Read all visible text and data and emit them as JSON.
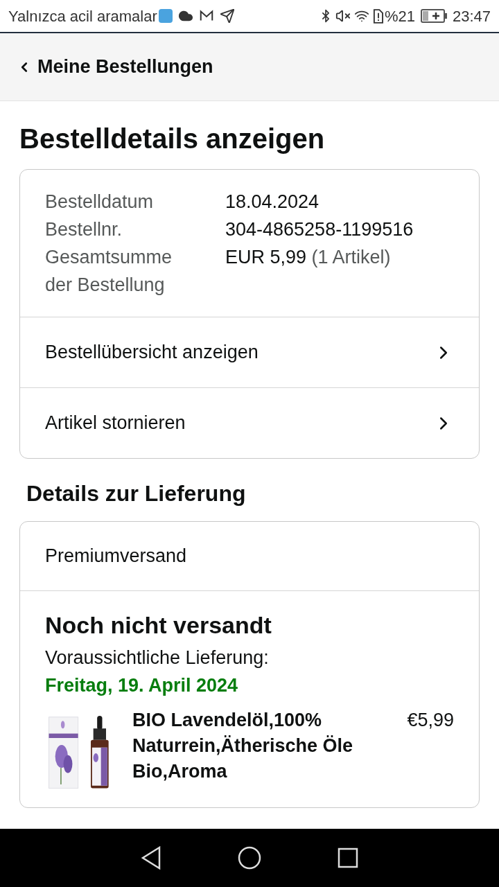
{
  "status_bar": {
    "carrier_text": "Yalnızca acil aramalar",
    "battery": "%21",
    "time": "23:47"
  },
  "header": {
    "title": "Meine Bestellungen"
  },
  "page_title": "Bestelldetails anzeigen",
  "order_summary": {
    "fields": [
      {
        "label": "Bestelldatum",
        "value": "18.04.2024"
      },
      {
        "label": "Bestellnr.",
        "value": "304-4865258-1199516"
      },
      {
        "label": "Gesamtsumme der Bestellung",
        "value": "EUR 5,99",
        "note": "(1 Artikel)"
      }
    ],
    "links": [
      "Bestellübersicht anzeigen",
      "Artikel stornieren"
    ]
  },
  "delivery": {
    "heading": "Details zur Lieferung",
    "shipping": "Premiumversand",
    "status": "Noch nicht versandt",
    "eta_label": "Voraussichtliche Lieferung:",
    "eta_date": "Freitag, 19. April 2024",
    "items": [
      {
        "title": "BIO Lavendelöl,100% Naturrein,Ätherische Öle Bio,Aroma",
        "price": "€5,99"
      }
    ]
  }
}
